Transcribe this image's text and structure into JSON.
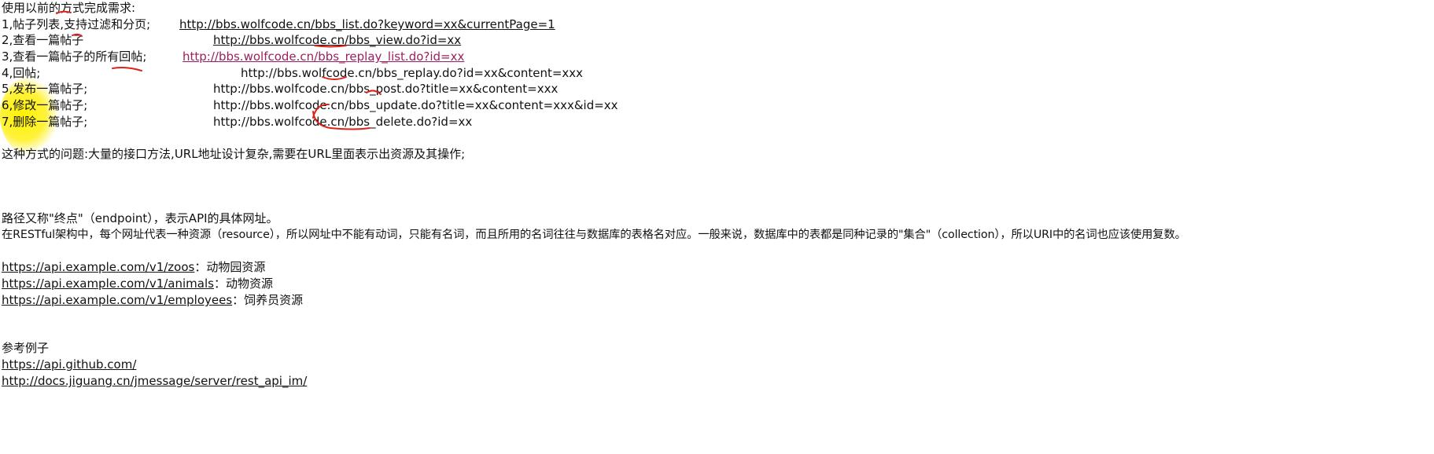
{
  "intro": "使用以前的方式完成需求:",
  "items": [
    {
      "label": "1,帖子列表,支持过滤和分页;",
      "url": "http://bbs.wolfcode.cn/bbs_list.do?keyword=xx&currentPage=1"
    },
    {
      "label": "2,查看一篇帖子",
      "url": "http://bbs.wolfcode.cn/bbs_view.do?id=xx"
    },
    {
      "label": "3,查看一篇帖子的所有回帖;",
      "url": "http://bbs.wolfcode.cn/bbs_replay_list.do?id=xx"
    },
    {
      "label": "4,回帖;",
      "url": "http://bbs.wolfcode.cn/bbs_replay.do?id=xx&content=xxx"
    },
    {
      "label": "5,发布一篇帖子;",
      "url": "http://bbs.wolfcode.cn/bbs_post.do?title=xx&content=xxx"
    },
    {
      "label": "6,修改一篇帖子;",
      "url": "http://bbs.wolfcode.cn/bbs_update.do?title=xx&content=xxx&id=xx"
    },
    {
      "label": "7,删除一篇帖子;",
      "url": "http://bbs.wolfcode.cn/bbs_delete.do?id=xx"
    }
  ],
  "problem": "这种方式的问题:大量的接口方法,URL地址设计复杂,需要在URL里面表示出资源及其操作;",
  "endpoint_title": "路径又称\"终点\"（endpoint），表示API的具体网址。",
  "endpoint_desc": "在RESTful架构中，每个网址代表一种资源（resource），所以网址中不能有动词，只能有名词，而且所用的名词往往与数据库的表格名对应。一般来说，数据库中的表都是同种记录的\"集合\"（collection），所以URI中的名词也应该使用复数。",
  "examples": [
    {
      "url": "https://api.example.com/v1/zoos",
      "desc": "：动物园资源"
    },
    {
      "url": "https://api.example.com/v1/animals",
      "desc": "：动物资源"
    },
    {
      "url": "https://api.example.com/v1/employees",
      "desc": "：饲养员资源"
    }
  ],
  "reference_title": "参考例子",
  "references": [
    "https://api.github.com/",
    "http://docs.jiguang.cn/jmessage/server/rest_api_im/"
  ],
  "colors": {
    "visited_link": "#9b2060",
    "annotation": "#d9231b",
    "highlight": "#fff200"
  }
}
